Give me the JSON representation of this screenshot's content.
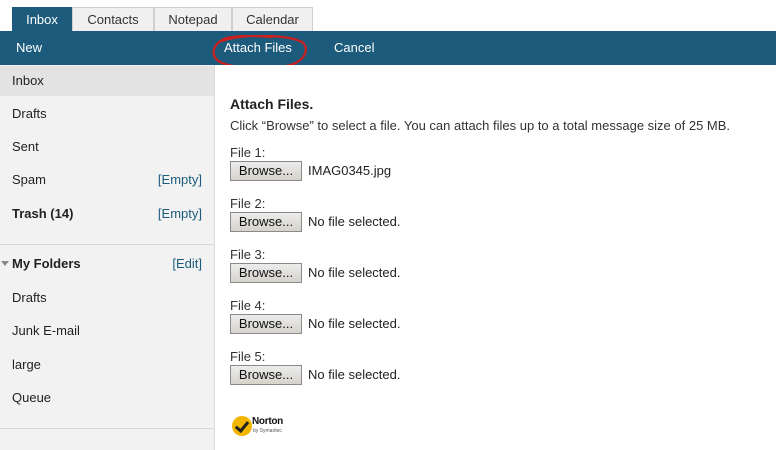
{
  "tabs": [
    {
      "label": "Inbox",
      "active": true
    },
    {
      "label": "Contacts",
      "active": false
    },
    {
      "label": "Notepad",
      "active": false
    },
    {
      "label": "Calendar",
      "active": false
    }
  ],
  "toolbar": {
    "new_label": "New",
    "attach_label": "Attach Files",
    "cancel_label": "Cancel",
    "highlight_color": "#cc1f1f"
  },
  "sidebar": {
    "mail_items": [
      {
        "label": "Inbox",
        "selected": true
      },
      {
        "label": "Drafts"
      },
      {
        "label": "Sent"
      },
      {
        "label": "Spam",
        "action": "[Empty]"
      },
      {
        "label": "Trash (14)",
        "action": "[Empty]",
        "bold": true
      }
    ],
    "folders_header": "My Folders",
    "folders_edit": "[Edit]",
    "folders": [
      {
        "label": "Drafts"
      },
      {
        "label": "Junk E-mail"
      },
      {
        "label": "large"
      },
      {
        "label": "Queue"
      }
    ]
  },
  "main": {
    "title": "Attach Files.",
    "description": "Click “Browse” to select a file. You can attach files up to a total message size of 25 MB.",
    "browse_label": "Browse...",
    "files": [
      {
        "label": "File 1:",
        "value": "IMAG0345.jpg"
      },
      {
        "label": "File 2:",
        "value": "No file selected."
      },
      {
        "label": "File 3:",
        "value": "No file selected."
      },
      {
        "label": "File 4:",
        "value": "No file selected."
      },
      {
        "label": "File 5:",
        "value": "No file selected."
      }
    ]
  },
  "norton": {
    "name": "Norton",
    "sub": "by Symantec",
    "icon": "checkmark-badge-icon"
  },
  "colors": {
    "accent": "#1d5b7d",
    "link": "#1d5b7d"
  }
}
